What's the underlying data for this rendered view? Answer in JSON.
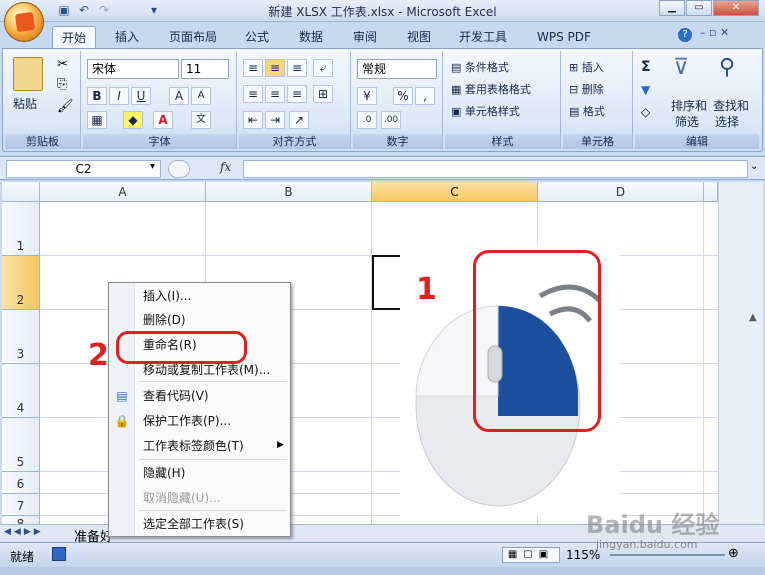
{
  "window": {
    "title": "新建 XLSX 工作表.xlsx - Microsoft Excel",
    "help_icon": "help-icon"
  },
  "tabs": [
    "开始",
    "插入",
    "页面布局",
    "公式",
    "数据",
    "审阅",
    "视图",
    "开发工具",
    "WPS PDF"
  ],
  "ribbon": {
    "clipboard": {
      "label": "剪贴板",
      "paste": "粘贴"
    },
    "font": {
      "label": "字体",
      "name": "宋体",
      "size": "11",
      "bold": "B",
      "italic": "I",
      "underline": "U"
    },
    "alignment": {
      "label": "对齐方式"
    },
    "number": {
      "label": "数字",
      "format": "常规",
      "percent": "%",
      "comma": ","
    },
    "styles": {
      "label": "样式",
      "conditional": "条件格式",
      "table": "套用表格格式",
      "cell": "单元格样式"
    },
    "cells": {
      "label": "单元格",
      "insert": "插入",
      "delete": "删除",
      "format": "格式"
    },
    "editing": {
      "label": "编辑",
      "sort1": "排序和",
      "sort2": "筛选",
      "find1": "查找和",
      "find2": "选择",
      "sigma": "Σ"
    }
  },
  "formula_bar": {
    "name_box": "C2",
    "fx": "fx",
    "value": ""
  },
  "grid": {
    "columns": [
      "A",
      "B",
      "C",
      "D"
    ],
    "selected_column": "C",
    "rows": [
      "1",
      "2",
      "3",
      "4",
      "5",
      "6",
      "7",
      "8"
    ],
    "selected_row": "2"
  },
  "context_menu": [
    {
      "label": "插入(I)...",
      "disabled": false
    },
    {
      "label": "删除(D)",
      "disabled": false
    },
    {
      "label": "重命名(R)",
      "disabled": false
    },
    {
      "label": "移动或复制工作表(M)...",
      "disabled": false
    },
    {
      "label": "查看代码(V)",
      "disabled": false
    },
    {
      "label": "保护工作表(P)...",
      "disabled": false
    },
    {
      "label": "工作表标签颜色(T)",
      "disabled": false
    },
    {
      "label": "隐藏(H)",
      "disabled": false
    },
    {
      "label": "取消隐藏(U)...",
      "disabled": true
    },
    {
      "label": "选定全部工作表(S)",
      "disabled": false
    }
  ],
  "annotations": {
    "one": "1",
    "two": "2"
  },
  "sheet_tabs": {
    "first": "准备好"
  },
  "status": {
    "ready": "就绪",
    "zoom": "115%"
  },
  "watermark": {
    "brand": "Baidu 经验",
    "url": "jingyan.baidu.com"
  },
  "colors": {
    "accent": "#f6c662",
    "annotation": "#e0201f",
    "mouse_blue": "#1c4f9c"
  }
}
